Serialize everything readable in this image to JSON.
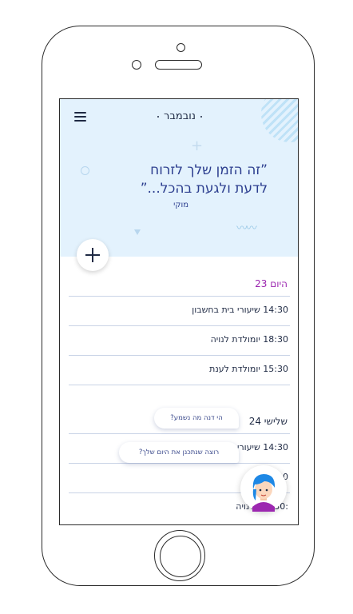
{
  "header": {
    "month": "נובמבר"
  },
  "hero": {
    "quote_line1": "”זה הזמן שלך לזרוח",
    "quote_line2": "לדעת ולגעת בהכל...”",
    "author": "מוקי"
  },
  "days": [
    {
      "label": "היום 23",
      "events": [
        "14:30 שיעורי בית בחשבון",
        "18:30 יומולדת לנויה",
        "15:30 יומולדת לענת"
      ]
    },
    {
      "label": "שלישי 24",
      "events": [
        "14:30 שיעורי ב",
        "30 לנויה",
        ":30 ...ת לנויה"
      ]
    }
  ],
  "chat": {
    "bubble1": "הי דנה מה נשמע?",
    "bubble2": "רוצה שנתכנן את היום שלך?"
  },
  "colors": {
    "hero_bg": "#e3f2fd",
    "today_accent": "#9c27b0",
    "primary_text": "#1f2a44",
    "quote_text": "#2c3e8f"
  },
  "icons": {
    "menu": "hamburger-menu-icon",
    "add": "plus-icon",
    "assistant": "assistant-avatar-icon"
  }
}
